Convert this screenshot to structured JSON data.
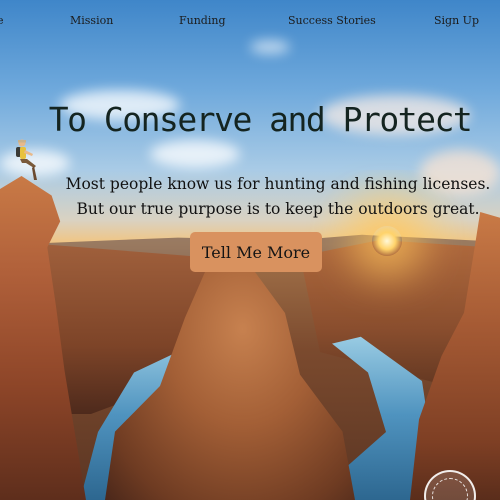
{
  "nav": {
    "items": [
      {
        "label": "e"
      },
      {
        "label": "Mission"
      },
      {
        "label": "Funding"
      },
      {
        "label": "Success Stories"
      },
      {
        "label": "Sign Up"
      }
    ]
  },
  "hero": {
    "title": "To Conserve and Protect",
    "subtitle": "Most people know us for hunting and fishing licenses. But our true purpose is to keep the outdoors great.",
    "cta_label": "Tell Me More",
    "background_image": "canyon-sunset-photo",
    "seal_icon": "agency-seal-icon"
  },
  "colors": {
    "cta_background": "#d9925f",
    "headline": "#142420",
    "text": "#111111"
  }
}
